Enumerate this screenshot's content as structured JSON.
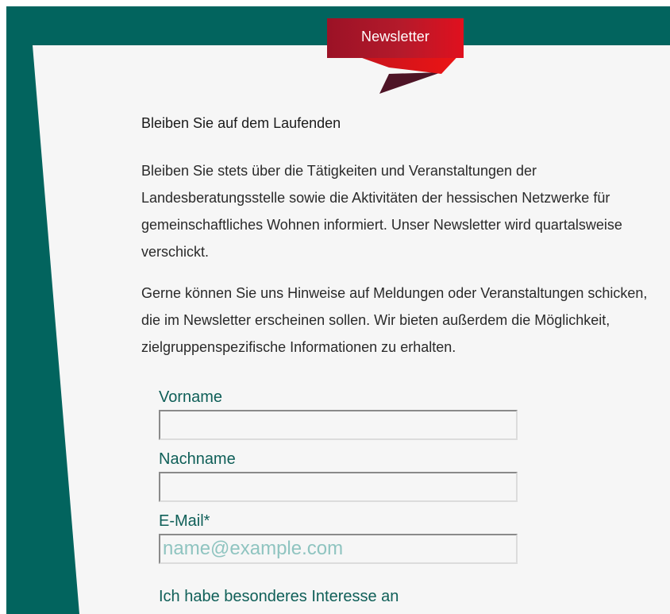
{
  "ribbon": {
    "label": "Newsletter"
  },
  "content": {
    "heading": "Bleiben Sie auf dem Laufenden",
    "paragraph1": "Bleiben Sie stets über die Tätigkeiten und Veranstaltungen der Landesberatungsstelle sowie die Aktivitäten der hessischen Netzwerke für gemeinschaftliches Wohnen informiert. Unser Newsletter wird quartalsweise verschickt.",
    "paragraph2": "Gerne können Sie uns Hinweise auf Meldungen oder Veranstaltungen schicken, die im Newsletter erscheinen sollen. Wir bieten außerdem die Möglichkeit, zielgruppenspezifische Informationen zu erhalten."
  },
  "form": {
    "firstname": {
      "label": "Vorname",
      "value": "",
      "placeholder": ""
    },
    "lastname": {
      "label": "Nachname",
      "value": "",
      "placeholder": ""
    },
    "email": {
      "label": "E-Mail*",
      "value": "",
      "placeholder": "name@example.com"
    },
    "interest_label": "Ich habe besonderes Interesse an"
  },
  "colors": {
    "frame_teal": "#02645e",
    "paper": "#f6f6f6",
    "ribbon_red": "#a8162a",
    "ribbon_fold": "#5a1428",
    "label_teal": "#0f5f58",
    "placeholder_teal": "#8fc4c0"
  }
}
